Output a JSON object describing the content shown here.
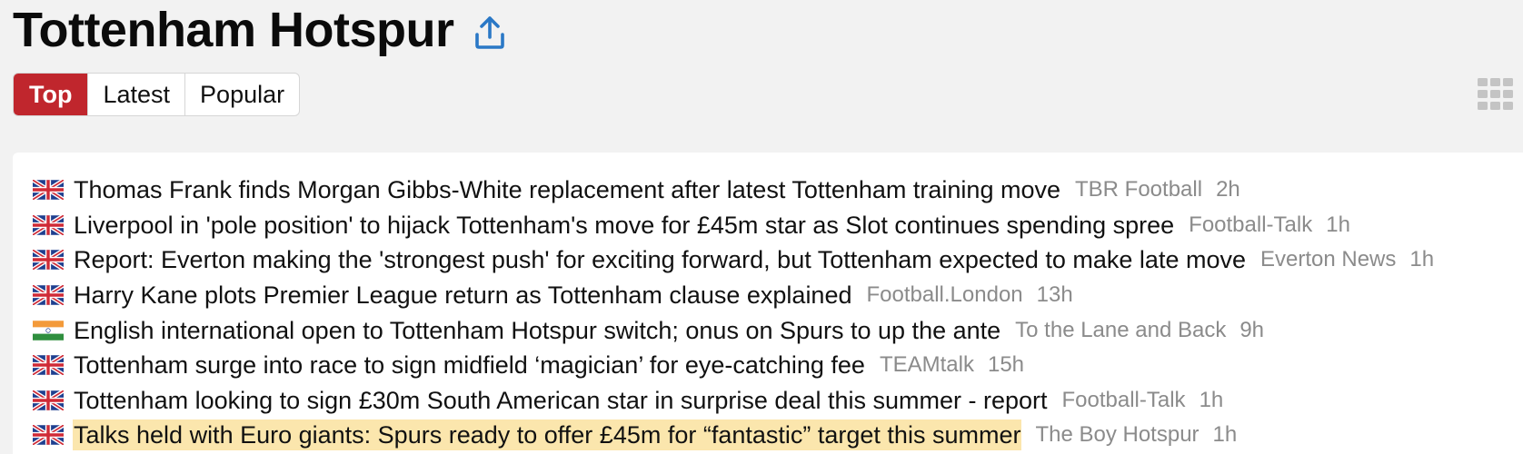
{
  "page": {
    "title": "Tottenham Hotspur"
  },
  "tabs": [
    {
      "label": "Top",
      "active": true
    },
    {
      "label": "Latest",
      "active": false
    },
    {
      "label": "Popular",
      "active": false
    }
  ],
  "colors": {
    "accent": "#c0262d",
    "share_icon": "#2a78c6",
    "highlight": "#fbe6ad",
    "muted_text": "#8b8b8b"
  },
  "icons": {
    "share": "share-upload-icon",
    "grid": "grid-view-icon"
  },
  "news": [
    {
      "flag": "uk",
      "headline": "Thomas Frank finds Morgan Gibbs-White replacement after latest Tottenham training move",
      "source": "TBR Football",
      "age": "2h",
      "highlighted": false
    },
    {
      "flag": "uk",
      "headline": "Liverpool in 'pole position' to hijack Tottenham's move for £45m star as Slot continues spending spree",
      "source": "Football-Talk",
      "age": "1h",
      "highlighted": false
    },
    {
      "flag": "uk",
      "headline": "Report: Everton making the 'strongest push' for exciting forward, but Tottenham expected to make late move",
      "source": "Everton News",
      "age": "1h",
      "highlighted": false
    },
    {
      "flag": "uk",
      "headline": "Harry Kane plots Premier League return as Tottenham clause explained",
      "source": "Football.London",
      "age": "13h",
      "highlighted": false
    },
    {
      "flag": "in",
      "headline": "English international open to Tottenham Hotspur switch; onus on Spurs to up the ante",
      "source": "To the Lane and Back",
      "age": "9h",
      "highlighted": false
    },
    {
      "flag": "uk",
      "headline": "Tottenham surge into race to sign midfield ‘magician’ for eye-catching fee",
      "source": "TEAMtalk",
      "age": "15h",
      "highlighted": false
    },
    {
      "flag": "uk",
      "headline": "Tottenham looking to sign £30m South American star in surprise deal this summer - report",
      "source": "Football-Talk",
      "age": "1h",
      "highlighted": false
    },
    {
      "flag": "uk",
      "headline": "Talks held with Euro giants: Spurs ready to offer £45m for “fantastic” target this summer",
      "source": "The Boy Hotspur",
      "age": "1h",
      "highlighted": true
    }
  ]
}
